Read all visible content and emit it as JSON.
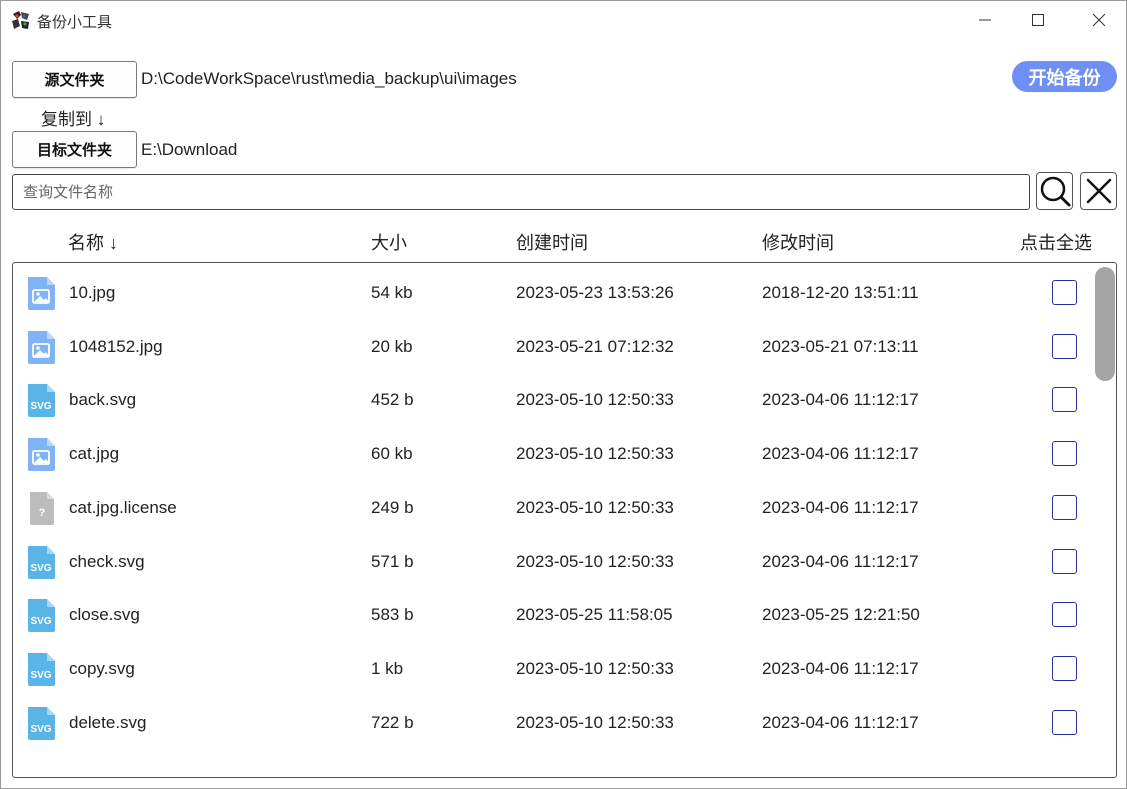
{
  "window": {
    "title": "备份小工具"
  },
  "toolbar": {
    "source_button": "源文件夹",
    "source_path": "D:\\CodeWorkSpace\\rust\\media_backup\\ui\\images",
    "copy_to_label": "复制到 ↓",
    "target_button": "目标文件夹",
    "target_path": "E:\\Download",
    "start_button": "开始备份"
  },
  "search": {
    "placeholder": "查询文件名称"
  },
  "columns": {
    "name": "名称 ↓",
    "size": "大小",
    "created": "创建时间",
    "modified": "修改时间",
    "select_all": "点击全选"
  },
  "files": [
    {
      "icon": "image-file-icon",
      "name": "10.jpg",
      "size": "54 kb",
      "created": "2023-05-23 13:53:26",
      "modified": "2018-12-20 13:51:11",
      "checked": false
    },
    {
      "icon": "image-file-icon",
      "name": "1048152.jpg",
      "size": "20 kb",
      "created": "2023-05-21 07:12:32",
      "modified": "2023-05-21 07:13:11",
      "checked": false
    },
    {
      "icon": "svg-file-icon",
      "name": "back.svg",
      "size": "452 b",
      "created": "2023-05-10 12:50:33",
      "modified": "2023-04-06 11:12:17",
      "checked": false
    },
    {
      "icon": "image-file-icon",
      "name": "cat.jpg",
      "size": "60 kb",
      "created": "2023-05-10 12:50:33",
      "modified": "2023-04-06 11:12:17",
      "checked": false
    },
    {
      "icon": "unknown-file-icon",
      "name": "cat.jpg.license",
      "size": "249 b",
      "created": "2023-05-10 12:50:33",
      "modified": "2023-04-06 11:12:17",
      "checked": false
    },
    {
      "icon": "svg-file-icon",
      "name": "check.svg",
      "size": "571 b",
      "created": "2023-05-10 12:50:33",
      "modified": "2023-04-06 11:12:17",
      "checked": false
    },
    {
      "icon": "svg-file-icon",
      "name": "close.svg",
      "size": "583 b",
      "created": "2023-05-25 11:58:05",
      "modified": "2023-05-25 12:21:50",
      "checked": false
    },
    {
      "icon": "svg-file-icon",
      "name": "copy.svg",
      "size": "1 kb",
      "created": "2023-05-10 12:50:33",
      "modified": "2023-04-06 11:12:17",
      "checked": false
    },
    {
      "icon": "svg-file-icon",
      "name": "delete.svg",
      "size": "722 b",
      "created": "2023-05-10 12:50:33",
      "modified": "2023-04-06 11:12:17",
      "checked": false
    }
  ],
  "colors": {
    "accent": "#6f8ff4",
    "checkbox_border": "#2e2e9a",
    "image_icon": "#7fb3f5",
    "svg_icon": "#5ab4e6",
    "unknown_icon": "#bdbdbd"
  }
}
